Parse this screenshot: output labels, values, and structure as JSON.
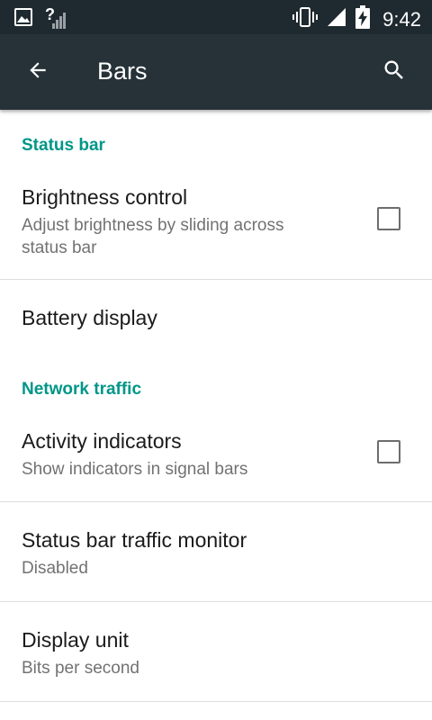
{
  "status_bar": {
    "time": "9:42",
    "signal_unknown_label": "?",
    "icons": [
      "image-icon",
      "signal-unknown-icon",
      "vibrate-icon",
      "cell-signal-icon",
      "battery-charging-icon"
    ]
  },
  "app_bar": {
    "title": "Bars",
    "back_icon": "arrow-back-icon",
    "search_icon": "search-icon"
  },
  "sections": {
    "status_bar": {
      "header": "Status bar",
      "brightness": {
        "title": "Brightness control",
        "summary": "Adjust brightness by sliding across status bar",
        "checked": false
      },
      "battery": {
        "title": "Battery display"
      }
    },
    "network_traffic": {
      "header": "Network traffic",
      "activity": {
        "title": "Activity indicators",
        "summary": "Show indicators in signal bars",
        "checked": false
      },
      "monitor": {
        "title": "Status bar traffic monitor",
        "summary": "Disabled"
      },
      "unit": {
        "title": "Display unit",
        "summary": "Bits per second"
      }
    }
  },
  "colors": {
    "accent": "#009688",
    "app_bar": "#263238",
    "status_bar": "#1f2a30"
  }
}
